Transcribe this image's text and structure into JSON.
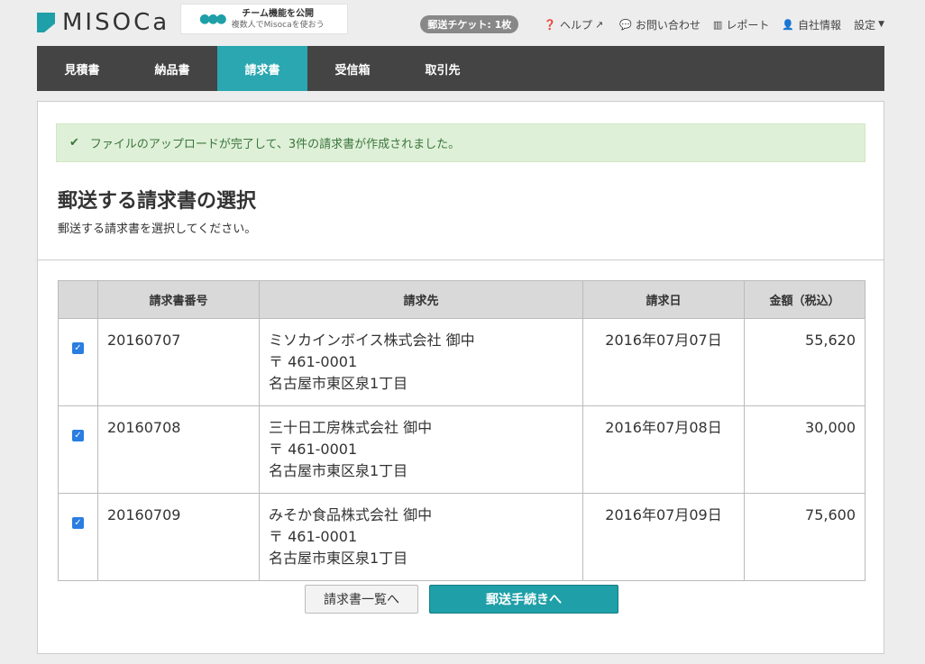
{
  "brand": {
    "logo_text": "MISOCa"
  },
  "promo": {
    "icon": "team-icon",
    "title": "チーム機能を公開",
    "sub": "複数人でMisocaを使おう"
  },
  "topnav": {
    "ticket": "郵送チケット: 1枚",
    "help": "ヘルプ",
    "contact": "お問い合わせ",
    "report": "レポート",
    "company": "自社情報",
    "settings": "設定"
  },
  "tabs": [
    {
      "label": "見積書"
    },
    {
      "label": "納品書"
    },
    {
      "label": "請求書"
    },
    {
      "label": "受信箱"
    },
    {
      "label": "取引先"
    }
  ],
  "alert": {
    "message": "ファイルのアップロードが完了して、3件の請求書が作成されました。"
  },
  "page": {
    "title": "郵送する請求書の選択",
    "subtitle": "郵送する請求書を選択してください。"
  },
  "table": {
    "headers": [
      "請求書番号",
      "請求先",
      "請求日",
      "金額（税込）"
    ],
    "rows": [
      {
        "checked": true,
        "number": "20160707",
        "customer": "ミソカインボイス株式会社 御中",
        "postal": "〒 461-0001",
        "address": "名古屋市東区泉1丁目",
        "date": "2016年07月07日",
        "amount": "55,620"
      },
      {
        "checked": true,
        "number": "20160708",
        "customer": "三十日工房株式会社 御中",
        "postal": "〒 461-0001",
        "address": "名古屋市東区泉1丁目",
        "date": "2016年07月08日",
        "amount": "30,000"
      },
      {
        "checked": true,
        "number": "20160709",
        "customer": "みそか食品株式会社 御中",
        "postal": "〒 461-0001",
        "address": "名古屋市東区泉1丁目",
        "date": "2016年07月09日",
        "amount": "75,600"
      }
    ]
  },
  "buttons": {
    "back": "請求書一覧へ",
    "proceed": "郵送手続きへ"
  },
  "colors": {
    "accent": "#2aa7b0",
    "nav_bg": "#444444",
    "success_bg": "#dff0d8",
    "checkbox": "#2a7de1"
  }
}
